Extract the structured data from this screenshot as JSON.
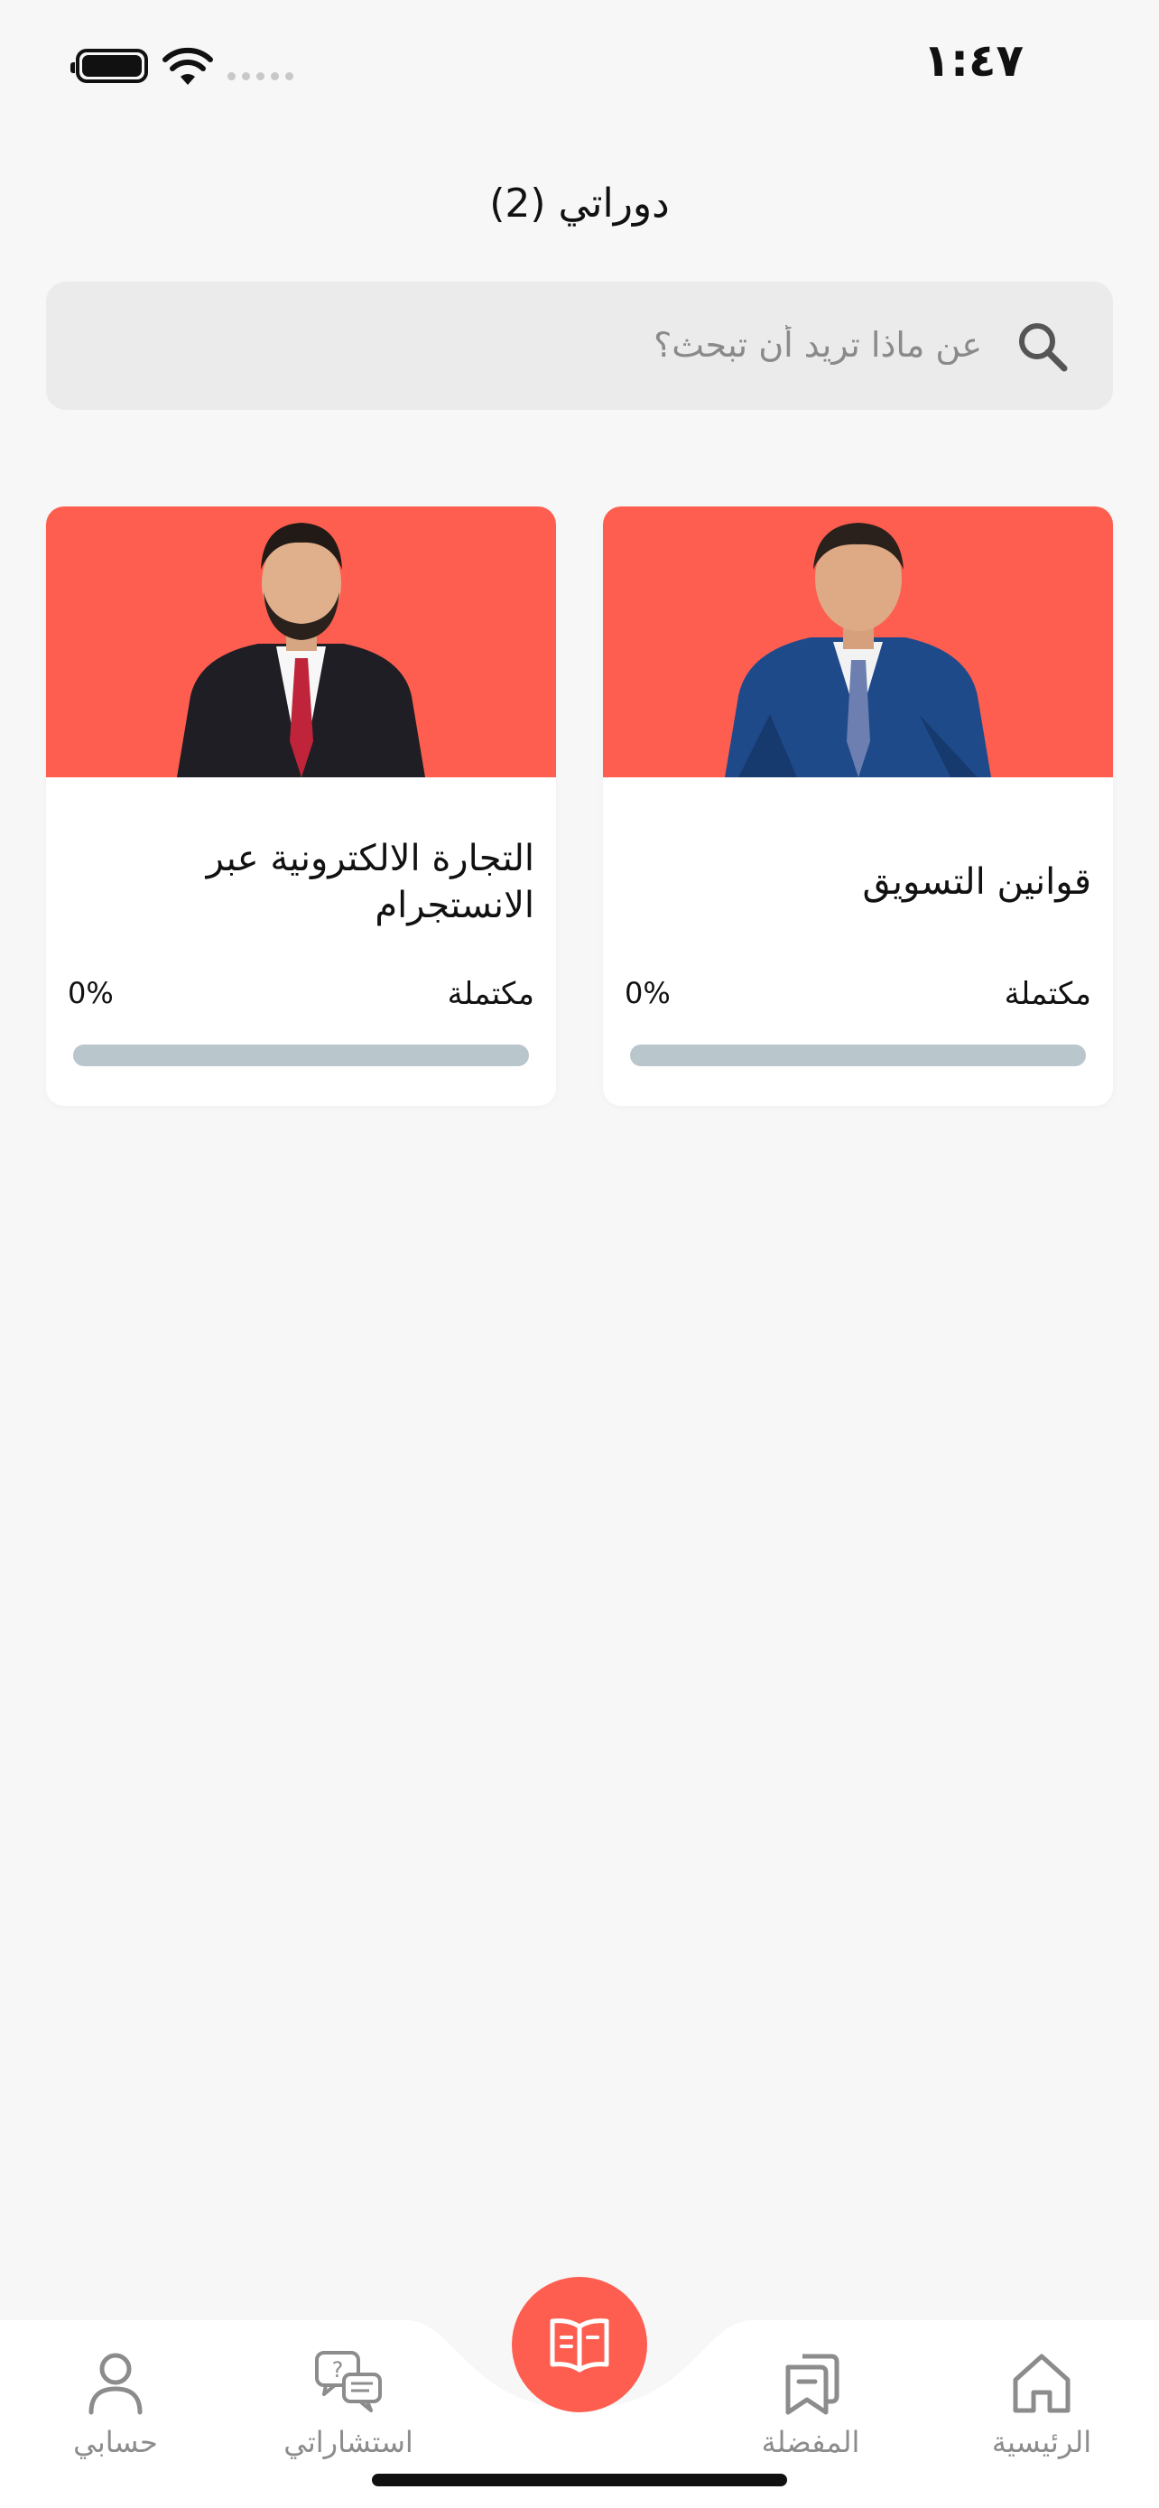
{
  "status_bar": {
    "time": "١:٤٧"
  },
  "header": {
    "title": "دوراتي (2)"
  },
  "search": {
    "placeholder": "عن ماذا تريد أن تبحث؟"
  },
  "courses": [
    {
      "title": "قوانين التسويق",
      "progress_label": "مكتملة",
      "progress_percent": "0%",
      "progress_value": 0,
      "image": "instructor-photo"
    },
    {
      "title": "التجارة الالكترونية عبر الانستجرام",
      "progress_label": "مكتملة",
      "progress_percent": "0%",
      "progress_value": 0,
      "image": "instructor-photo"
    }
  ],
  "bottom_nav": {
    "items": [
      {
        "label": "الرئيسية",
        "icon": "home-icon"
      },
      {
        "label": "المفضلة",
        "icon": "bookmarks-icon"
      },
      {
        "label": "",
        "icon": "open-book-icon"
      },
      {
        "label": "استشاراتي",
        "icon": "chat-question-icon"
      },
      {
        "label": "حسابي",
        "icon": "user-icon"
      }
    ]
  },
  "colors": {
    "accent": "#fe5e50",
    "background": "#f7f7f7",
    "search_bg": "#ebebeb",
    "progress_track": "#b9c6cb",
    "nav_label": "#8c8c8c"
  }
}
